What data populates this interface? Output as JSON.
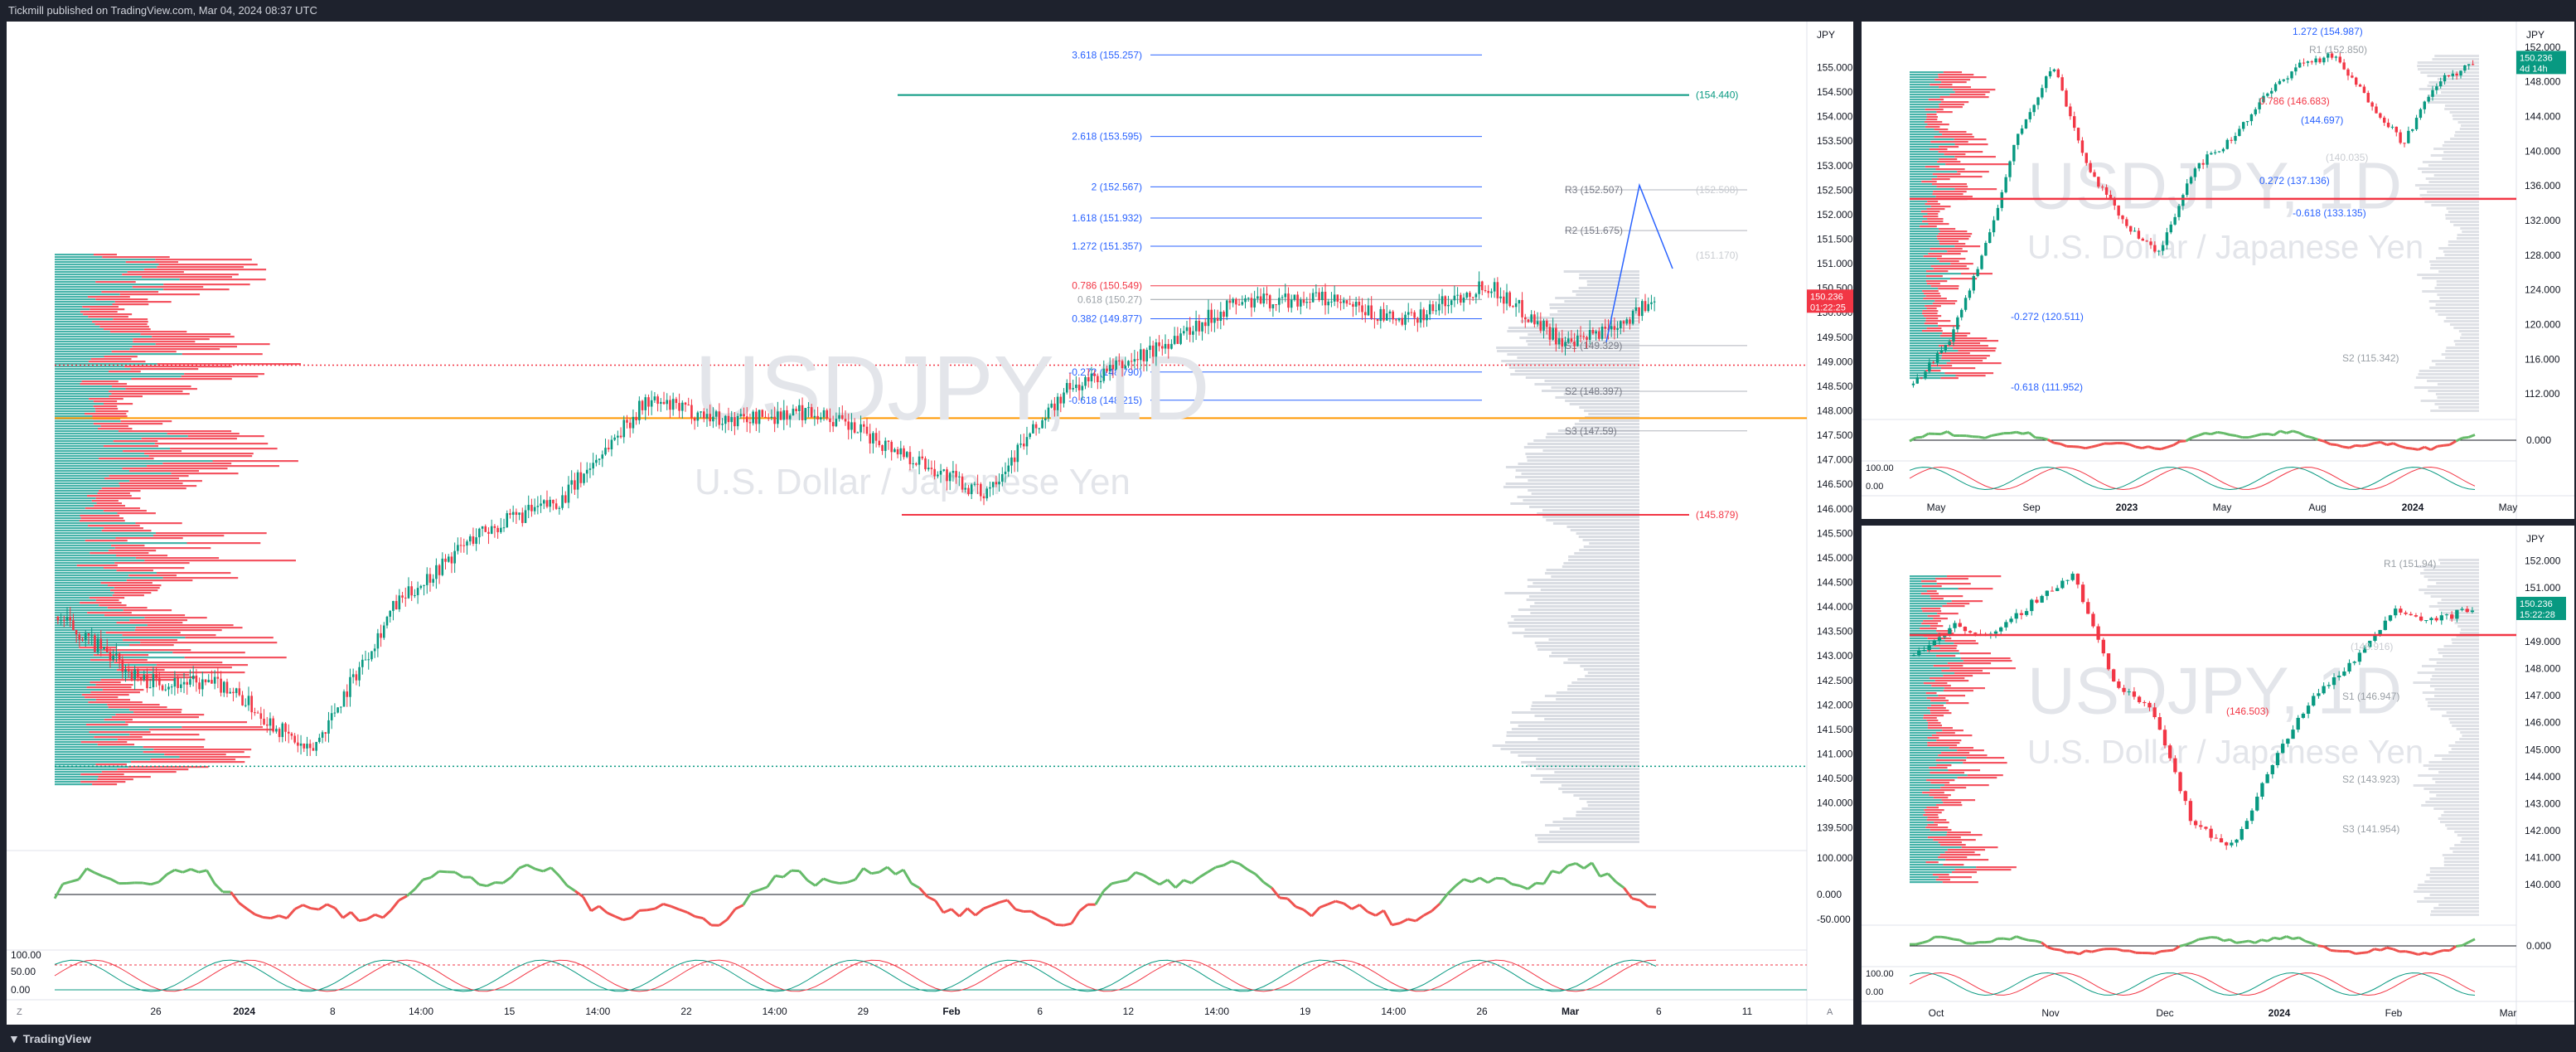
{
  "header": {
    "publisher_text": "Tickmill published on TradingView.com, Mar 04, 2024 08:37 UTC"
  },
  "footer": {
    "brand": "TradingView"
  },
  "watermark": {
    "symbol": "USDJPY, 1D",
    "description": "U.S. Dollar / Japanese Yen"
  },
  "chart_data": [
    {
      "type": "candlestick",
      "panel": "main-1h",
      "currency": "JPY",
      "last_price": "150.236",
      "countdown": "01:22:25",
      "ylim": [
        139.2,
        155.6
      ],
      "y_ticks": [
        "155.000",
        "154.500",
        "154.000",
        "153.500",
        "153.000",
        "152.500",
        "152.000",
        "151.500",
        "151.000",
        "150.500",
        "150.000",
        "149.500",
        "149.000",
        "148.500",
        "148.000",
        "147.500",
        "147.000",
        "146.500",
        "146.000",
        "145.500",
        "145.000",
        "144.500",
        "144.000",
        "143.500",
        "143.000",
        "142.500",
        "142.000",
        "141.500",
        "141.000",
        "140.500",
        "140.000",
        "139.500"
      ],
      "x_ticks": [
        "26",
        "2024",
        "8",
        "14:00",
        "15",
        "14:00",
        "22",
        "14:00",
        "29",
        "Feb",
        "6",
        "12",
        "14:00",
        "19",
        "14:00",
        "26",
        "Mar",
        "6",
        "11"
      ],
      "fib_levels": [
        {
          "label": "3.618 (155.257)",
          "value": 155.257,
          "color": "#2962ff"
        },
        {
          "label": "2.618 (153.595)",
          "value": 153.595,
          "color": "#2962ff"
        },
        {
          "label": "2 (152.567)",
          "value": 152.567,
          "color": "#2962ff"
        },
        {
          "label": "1.618 (151.932)",
          "value": 151.932,
          "color": "#2962ff"
        },
        {
          "label": "1.272 (151.357)",
          "value": 151.357,
          "color": "#2962ff"
        },
        {
          "label": "0.786 (150.549)",
          "value": 150.549,
          "color": "#f23645"
        },
        {
          "label": "0.618 (150.27)",
          "value": 150.27,
          "color": "#9aa0a6"
        },
        {
          "label": "0.382 (149.877)",
          "value": 149.877,
          "color": "#2962ff"
        },
        {
          "label": "-0.272 (148.790)",
          "value": 148.79,
          "color": "#2962ff"
        },
        {
          "label": "-0.618 (148.215)",
          "value": 148.215,
          "color": "#2962ff"
        }
      ],
      "pivots": [
        {
          "label": "R3 (152.507)",
          "value": 152.507
        },
        {
          "label": "R2 (151.675)",
          "value": 151.675
        },
        {
          "label": "S1 (149.329)",
          "value": 149.329
        },
        {
          "label": "S2 (148.397)",
          "value": 148.397
        },
        {
          "label": "S3 (147.59)",
          "value": 147.59
        }
      ],
      "levels": [
        {
          "label": "(154.440)",
          "value": 154.44,
          "color": "#089981"
        },
        {
          "label": "(145.879)",
          "value": 145.879,
          "color": "#f23645"
        },
        {
          "label": "(152.508)",
          "value": 152.508,
          "color": "#c9ccd1"
        },
        {
          "label": "(151.170)",
          "value": 151.17,
          "color": "#c9ccd1"
        }
      ],
      "oscillator_ticks": [
        "100.000",
        "0.000",
        "-50.000"
      ],
      "stoch_ticks": [
        "100.00",
        "50.00",
        "0.00"
      ],
      "toolbar_z": "Z",
      "toolbar_a": "A"
    },
    {
      "type": "candlestick",
      "panel": "weekly",
      "currency": "JPY",
      "last_price": "150.236",
      "countdown": "4d 14h",
      "ylim": [
        110,
        154
      ],
      "y_ticks": [
        "152.000",
        "148.000",
        "144.000",
        "140.000",
        "136.000",
        "132.000",
        "128.000",
        "124.000",
        "120.000",
        "116.000",
        "112.000"
      ],
      "x_ticks": [
        "May",
        "Sep",
        "2023",
        "May",
        "Aug",
        "2024",
        "May"
      ],
      "labels": [
        "1.272 (154.987)",
        "R1 (152.850)",
        "0.786 (146.683)",
        "(144.697)",
        "(140.035)",
        "0.272 (137.136)",
        "-0.618 (133.135)",
        "-0.272 (120.511)",
        "-0.618 (111.952)",
        "S2 (115.342)"
      ],
      "oscillator_ticks": [
        "0.000"
      ],
      "stoch_ticks": [
        "100.00",
        "0.00"
      ]
    },
    {
      "type": "candlestick",
      "panel": "daily",
      "currency": "JPY",
      "last_price": "150.236",
      "countdown": "15:22:28",
      "ylim": [
        138.8,
        153
      ],
      "y_ticks": [
        "152.000",
        "151.000",
        "150.000",
        "149.000",
        "148.000",
        "147.000",
        "146.000",
        "145.000",
        "144.000",
        "143.000",
        "142.000",
        "141.000",
        "140.000"
      ],
      "x_ticks": [
        "Oct",
        "Nov",
        "Dec",
        "2024",
        "Feb",
        "Mar"
      ],
      "labels": [
        "R1 (151.94)",
        "(148.916)",
        "S1 (146.947)",
        "(146.503)",
        "S2 (143.923)",
        "S3 (141.954)"
      ],
      "oscillator_ticks": [
        "0.000"
      ],
      "stoch_ticks": [
        "100.00",
        "0.00"
      ]
    }
  ]
}
